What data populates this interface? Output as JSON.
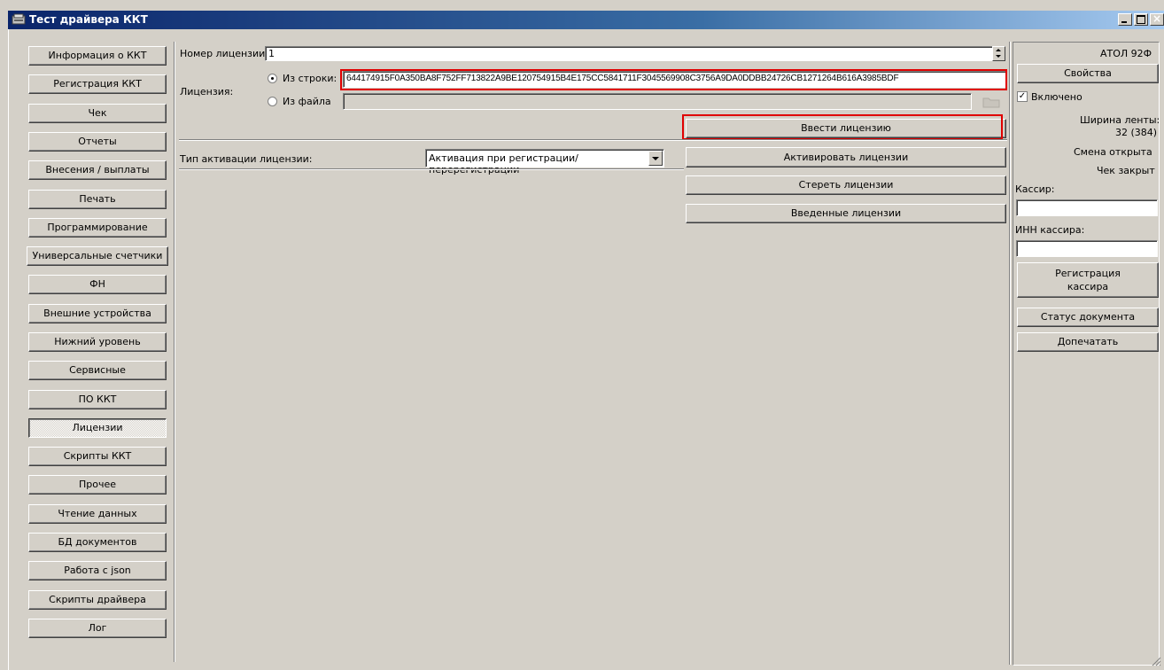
{
  "window": {
    "title": "Тест драйвера ККТ"
  },
  "sidebar": {
    "items": [
      {
        "label": "Информация о ККТ"
      },
      {
        "label": "Регистрация ККТ"
      },
      {
        "label": "Чек"
      },
      {
        "label": "Отчеты"
      },
      {
        "label": "Внесения / выплаты"
      },
      {
        "label": "Печать"
      },
      {
        "label": "Программирование"
      },
      {
        "label": "Универсальные счетчики"
      },
      {
        "label": "ФН"
      },
      {
        "label": "Внешние устройства"
      },
      {
        "label": "Нижний уровень"
      },
      {
        "label": "Сервисные"
      },
      {
        "label": "ПО ККТ"
      },
      {
        "label": "Лицензии"
      },
      {
        "label": "Скрипты ККТ"
      },
      {
        "label": "Прочее"
      },
      {
        "label": "Чтение данных"
      },
      {
        "label": "БД документов"
      },
      {
        "label": "Работа с json"
      },
      {
        "label": "Скрипты драйвера"
      },
      {
        "label": "Лог"
      }
    ],
    "selected": "Лицензии"
  },
  "license": {
    "number_label": "Номер лицензии:",
    "number_value": "1",
    "license_label": "Лицензия:",
    "from_string_label": "Из строки:",
    "from_string_value": "644174915F0A350BA8F752FF713822A9BE120754915B4E175CC5841711F3045569908C3756A9DA0DDBB24726CB1271264B616A3985BDF",
    "from_file_label": "Из файла",
    "from_file_value": "",
    "enter_button": "Ввести лицензию",
    "activation_type_label": "Тип активации лицензии:",
    "activation_type_value": "Активация при регистрации/перерегистрации",
    "activate_button": "Активировать лицензии",
    "erase_button": "Стереть лицензии",
    "entered_button": "Введенные лицензии"
  },
  "right_panel": {
    "device_name": "АТОЛ 92Ф",
    "properties_button": "Свойства",
    "enabled_label": "Включено",
    "enabled_checked": true,
    "tape_width_label": "Ширина ленты:",
    "tape_width_value": "32 (384)",
    "shift_status": "Смена открыта",
    "receipt_status": "Чек закрыт",
    "cashier_label": "Кассир:",
    "cashier_value": "",
    "cashier_inn_label": "ИНН кассира:",
    "cashier_inn_value": "",
    "register_cashier_line1": "Регистрация",
    "register_cashier_line2": "кассира",
    "doc_status_button": "Статус документа",
    "reprint_button": "Допечатать"
  },
  "colors": {
    "highlight": "#e00000",
    "titlebar": "#0a246a",
    "face": "#d4d0c8"
  }
}
